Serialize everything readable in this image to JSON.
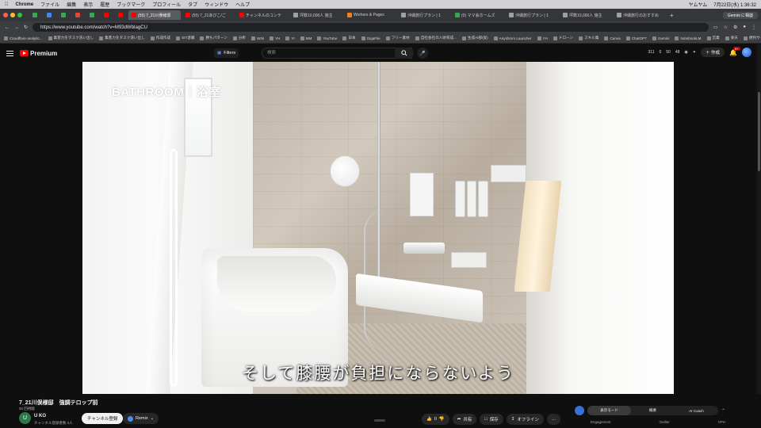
{
  "mac_menu": {
    "apple": "",
    "app": "Chrome",
    "items": [
      "ファイル",
      "編集",
      "表示",
      "履歴",
      "ブックマーク",
      "プロフィール",
      "タブ",
      "ウィンドウ",
      "ヘルプ"
    ],
    "clock": "7月22日(水) 1:36:32",
    "battery": "ヤムヤム"
  },
  "tabs": [
    {
      "label": "",
      "color": "#34a853",
      "kind": "small"
    },
    {
      "label": "",
      "color": "#4285f4",
      "kind": "small"
    },
    {
      "label": "",
      "color": "#34a853",
      "kind": "small"
    },
    {
      "label": "",
      "color": "#ea4335",
      "kind": "small"
    },
    {
      "label": "",
      "color": "#34a853",
      "kind": "small"
    },
    {
      "label": "",
      "color": "#ff0000",
      "kind": "small"
    },
    {
      "label": "",
      "color": "#ff0000",
      "kind": "small"
    },
    {
      "label": "(55) 7_21川俣様邸",
      "color": "#ff0000",
      "kind": "active"
    },
    {
      "label": "(55) 7_21あびこ/ご",
      "color": "#ff0000",
      "kind": "wide"
    },
    {
      "label": "チャンネルのコンテ",
      "color": "#ff0000",
      "kind": "wide"
    },
    {
      "label": "坪数10,000人 施主",
      "color": "#9aa0a6",
      "kind": "wide"
    },
    {
      "label": "Workers & Pages",
      "color": "#f38020",
      "kind": "wide"
    },
    {
      "label": "沖縄旅行プラン | 1",
      "color": "#9aa0a6",
      "kind": "wide"
    },
    {
      "label": "(0) ママ会ホームズ",
      "color": "#34a853",
      "kind": "wide"
    },
    {
      "label": "沖縄旅行プラン | 1",
      "color": "#9aa0a6",
      "kind": "wide"
    },
    {
      "label": "坪数10,000人 施主",
      "color": "#9aa0a6",
      "kind": "wide"
    },
    {
      "label": "沖縄旅行のおすすめ",
      "color": "#9aa0a6",
      "kind": "wide"
    }
  ],
  "gemini_button": "Gemini に相談",
  "address": {
    "url": "https://www.youtube.com/watch?v=M93dWbIagCU"
  },
  "bookmarks": [
    "Cloudflare analytic...",
    "集客力をタスク洗い出し",
    "集客力をタスク洗い出し",
    "作成作成",
    "SIT退職",
    "勝ちパターン",
    "分析",
    "WIN",
    "YH",
    "YI",
    "MM",
    "YouTube",
    "日本",
    "GigaFile",
    "フリー素材",
    "自社会社の人財育成...",
    "生成AI部(仮)",
    "Anyshmm Launcher",
    "YH",
    "ドローン",
    "スキル集",
    "Canva",
    "ChatGPT",
    "Gemini",
    "NotebookLM",
    "営業",
    "楽天",
    "便利サイト"
  ],
  "youtube": {
    "brand": "Premium",
    "filters_label": "Filters",
    "search_placeholder": "検索",
    "stats": [
      "311",
      "0",
      "50",
      "48"
    ],
    "create_label": "作成",
    "notifications": "9+"
  },
  "video": {
    "overlay_title": "BATHROOM｜浴室",
    "subtitle": "そして膝腰が負担にならないよう"
  },
  "details": {
    "title": "7_21川俣様邸　強調テロップ前",
    "meta": "00 回視聴",
    "channel_initial": "U",
    "channel_name": "U KO",
    "channel_subs": "チャンネル登録者数 3人",
    "subscribe_label": "チャンネル登録",
    "remix_label": "Remix",
    "likes": "0",
    "share_label": "共有",
    "save_label": "保存",
    "offline_label": "オフライン",
    "more_label": "…"
  },
  "right_panel": {
    "segments": [
      "表示モード",
      "概要",
      "AI Coach"
    ],
    "labels": [
      "Engagement",
      "Outlier",
      "VPH"
    ]
  }
}
